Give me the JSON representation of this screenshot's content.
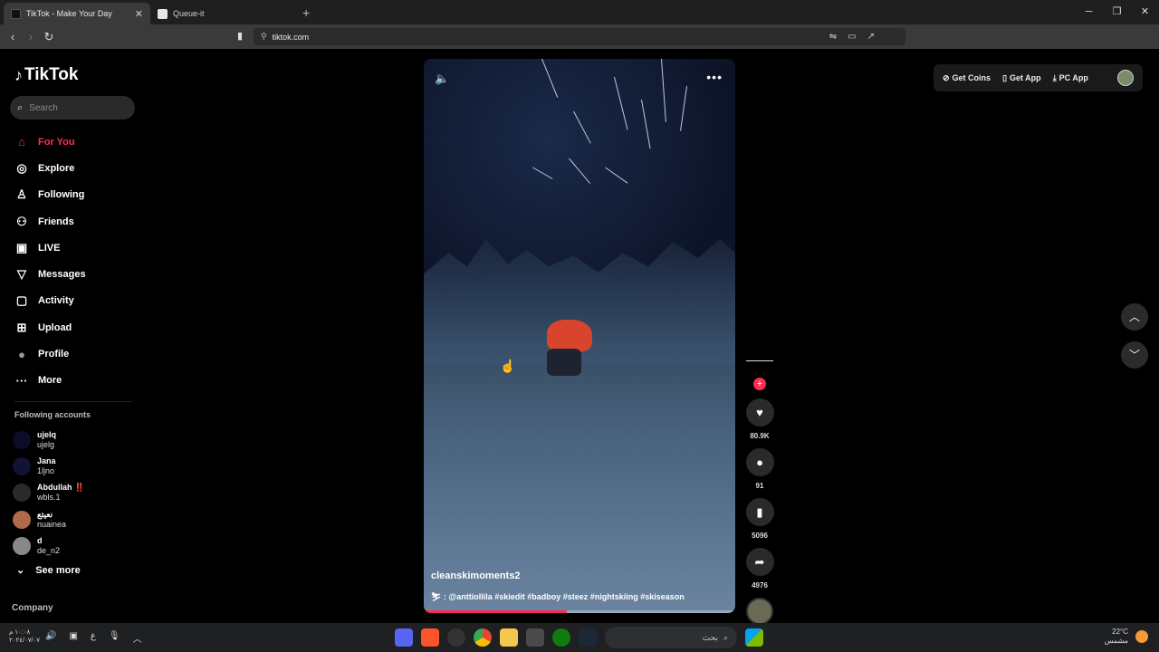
{
  "browser": {
    "tabs": [
      {
        "title": "TikTok - Make Your Day",
        "active": true
      },
      {
        "title": "Queue-it",
        "active": false
      }
    ],
    "new_tab": "+",
    "window_controls": [
      "─",
      "❐",
      "✕"
    ],
    "url": "tiktok.com",
    "nav_icons": [
      "back-icon",
      "forward-icon",
      "reload-icon"
    ]
  },
  "sidebar": {
    "logo_text": "TikTok",
    "search_placeholder": "Search",
    "items": [
      {
        "label": "For You",
        "icon": "home-icon",
        "glyph": "⌂"
      },
      {
        "label": "Explore",
        "icon": "compass-icon",
        "glyph": "◎"
      },
      {
        "label": "Following",
        "icon": "following-icon",
        "glyph": "♙"
      },
      {
        "label": "Friends",
        "icon": "friends-icon",
        "glyph": "⚇"
      },
      {
        "label": "LIVE",
        "icon": "live-icon",
        "glyph": "▣"
      },
      {
        "label": "Messages",
        "icon": "messages-icon",
        "glyph": "▽"
      },
      {
        "label": "Activity",
        "icon": "activity-icon",
        "glyph": "▢"
      },
      {
        "label": "Upload",
        "icon": "upload-icon",
        "glyph": "⊞"
      },
      {
        "label": "Profile",
        "icon": "profile-avatar",
        "glyph": "●"
      },
      {
        "label": "More",
        "icon": "more-icon",
        "glyph": "···"
      }
    ],
    "following_title": "Following accounts",
    "following": [
      {
        "name": "ujelq",
        "handle": "ujelg",
        "color": "#0b0b2a"
      },
      {
        "name": "Jana",
        "handle": "1ljno",
        "color": "#121233"
      },
      {
        "name": "Abdullah ‼️",
        "handle": "wbls.1",
        "color": "#222"
      },
      {
        "name": "نعيتع",
        "handle": "nuainea",
        "color": "#b06a4a"
      },
      {
        "name": "d",
        "handle": "de_n2",
        "color": "#888"
      }
    ],
    "see_more": "See more",
    "company": "Company"
  },
  "video": {
    "username": "cleanskimoments2",
    "description": "⛷ : @anttiollila #skiedit #badboy #steez #nightskiing #skiseason",
    "progress": 0.46
  },
  "actions": {
    "likes": "80.9K",
    "comments": "91",
    "saves": "5096",
    "shares": "4976"
  },
  "topbar": {
    "coins": "Get Coins",
    "app": "Get App",
    "pc_app": "PC App"
  },
  "taskbar": {
    "time": "١٠:٠٨ م",
    "date": "٢٠٢٤/٠٧/٠٧",
    "lang": "ع",
    "search_label": "بحث",
    "weather_temp": "22°C",
    "weather_desc": "مشمس"
  }
}
